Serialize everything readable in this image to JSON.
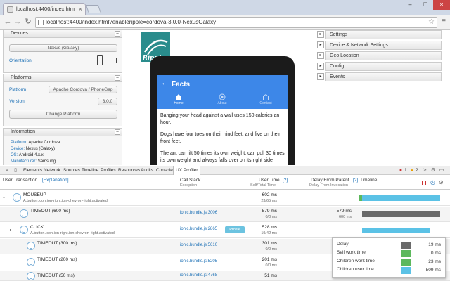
{
  "browser": {
    "tab_title": "localhost:4400/index.htm",
    "tab_close": "×",
    "url": "localhost:4400/index.html?enableripple=cordova-3.0.0-NexusGalaxy",
    "window_min": "–",
    "window_max": "□",
    "window_close": "×"
  },
  "left_panels": {
    "devices": {
      "title": "Devices",
      "device_value": "Nexus (Galaxy)",
      "orientation_label": "Orientation"
    },
    "platforms": {
      "title": "Platforms",
      "platform_label": "Platform",
      "platform_value": "Apache Cordova / PhoneGap",
      "version_label": "Version",
      "version_value": "3.0.0",
      "change_button": "Change Platform"
    },
    "information": {
      "title": "Information",
      "rows": [
        {
          "label": "Platform:",
          "value": "Apache Cordova"
        },
        {
          "label": "Device:",
          "value": "Nexus (Galaxy)"
        },
        {
          "label": "OS:",
          "value": "Android 4.x.x"
        },
        {
          "label": "Manufacturer:",
          "value": "Samsung"
        }
      ]
    }
  },
  "right_panels": [
    "Settings",
    "Device & Network Settings",
    "Geo Location",
    "Config",
    "Events"
  ],
  "app": {
    "title": "Facts",
    "tabs": [
      "Home",
      "About",
      "Contact"
    ],
    "paragraphs": [
      "Banging your head against a wall uses 150 calories an hour.",
      "Dogs have four toes on their hind feet, and five on their front feet.",
      "The ant can lift 50 times its own weight, can pull 30 times its own weight and always falls over on its right side when intoxicated."
    ]
  },
  "devtools": {
    "tabs": [
      "Elements",
      "Network",
      "Sources",
      "Timeline",
      "Profiles",
      "Resources",
      "Audits",
      "Console",
      "UX Profiler"
    ],
    "active_tab": "UX Profiler",
    "counts": {
      "errors": "1",
      "warnings": "2"
    },
    "columns": {
      "transaction": "User Transaction",
      "explanation": "[Explanation]",
      "callstack": "Call Stack",
      "callstack_sub": "Exception",
      "usertime": "User Time",
      "usertime_sub": "Self/Total Time",
      "delay": "Delay From Parent",
      "delay_sub": "Delay From Invocation",
      "timeline": "Timeline",
      "q1": "[?]",
      "q2": "[?]",
      "q3": "[?]"
    },
    "profile_label": "Profile",
    "rows": [
      {
        "name": "MOUSEUP",
        "sub": "A.button.icon.ion-right.ion-chevron-right.activated",
        "call": "",
        "ut": "602 ms",
        "st": "23/65 ms",
        "d": "",
        "dsub": "",
        "expander": "▾"
      },
      {
        "name": "TIMEOUT (600 ms)",
        "sub": "",
        "call": "ionic.bundle.js:3006",
        "ut": "579 ms",
        "st": "0/0 ms",
        "d": "579 ms",
        "dsub": "600 ms",
        "expander": ""
      },
      {
        "name": "CLICK",
        "sub": "A.button.icon.ion-right.ion-chevron-right.activated",
        "call": "ionic.bundle.js:2865",
        "ut": "528 ms",
        "st": "19/42 ms",
        "d": "",
        "dsub": "",
        "expander": "▸"
      },
      {
        "name": "TIMEOUT (300 ms)",
        "sub": "",
        "call": "ionic.bundle.js:5610",
        "ut": "301 ms",
        "st": "0/0 ms",
        "d": "",
        "dsub": "",
        "expander": ""
      },
      {
        "name": "TIMEOUT (200 ms)",
        "sub": "",
        "call": "ionic.bundle.js:5205",
        "ut": "201 ms",
        "st": "0/0 ms",
        "d": "",
        "dsub": "",
        "expander": ""
      },
      {
        "name": "TIMEOUT (50 ms)",
        "sub": "",
        "call": "ionic.bundle.js:4768",
        "ut": "51 ms",
        "st": "",
        "d": "",
        "dsub": "",
        "expander": ""
      }
    ],
    "tooltip": [
      {
        "label": "Delay",
        "value": "19 ms",
        "color": "#6a6a6a"
      },
      {
        "label": "Self work time",
        "value": "0 ms",
        "color": "#5cb85c"
      },
      {
        "label": "Children work time",
        "value": "23 ms",
        "color": "#5cb85c"
      },
      {
        "label": "Children user time",
        "value": "509 ms",
        "color": "#5bc2e6"
      }
    ]
  },
  "colors": {
    "app_header": "#3d87e8",
    "link": "#1b6fb5",
    "tl_blue": "#5bc2e6",
    "tl_gray": "#6a6a6a"
  }
}
